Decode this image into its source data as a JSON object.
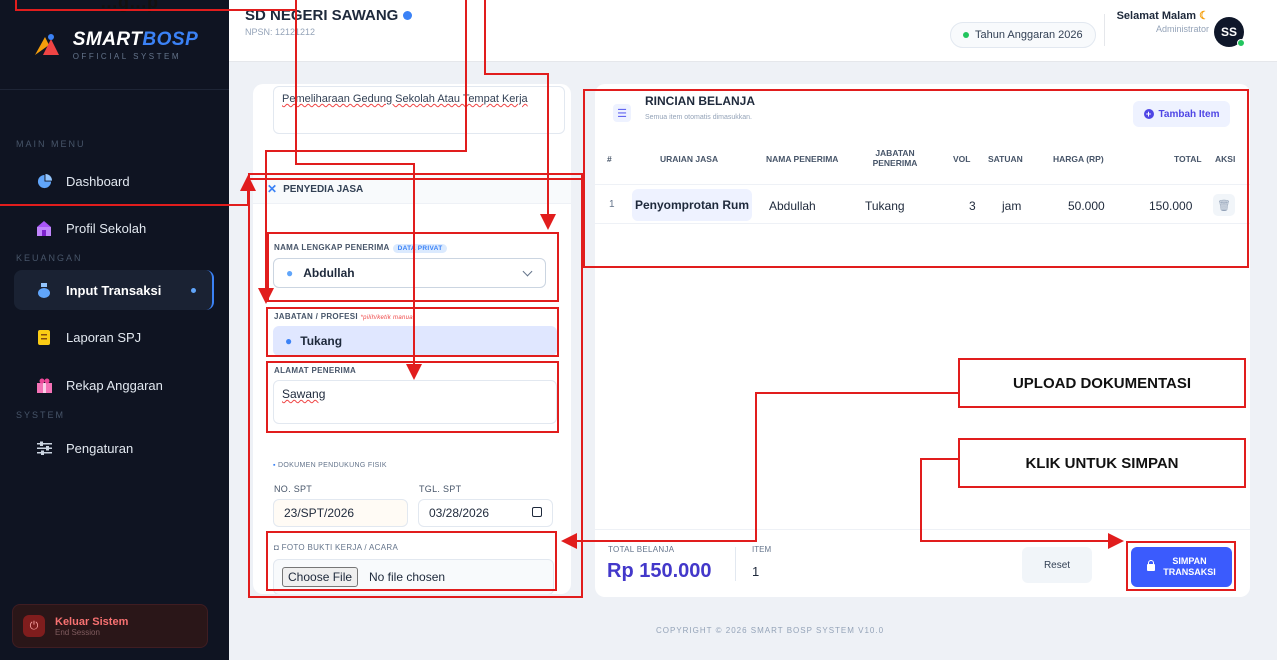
{
  "sidebar": {
    "logo_title_main": "SMART",
    "logo_title_accent": "BOSP",
    "logo_subtitle": "OFFICIAL SYSTEM",
    "section_main": "MAIN MENU",
    "section_finance": "KEUANGAN",
    "section_system": "SYSTEM",
    "items": [
      {
        "label": "Dashboard",
        "icon": "pie-chart-icon"
      },
      {
        "label": "Profil Sekolah",
        "icon": "school-icon"
      },
      {
        "label": "Input Transaksi",
        "icon": "money-bag-icon",
        "active": true
      },
      {
        "label": "Laporan SPJ",
        "icon": "document-icon"
      },
      {
        "label": "Rekap Anggaran",
        "icon": "gift-icon"
      },
      {
        "label": "Pengaturan",
        "icon": "sliders-icon"
      }
    ],
    "logout_title": "Keluar Sistem",
    "logout_sub": "End Session"
  },
  "header": {
    "school_name": "SD NEGERI SAWANG",
    "npsn": "NPSN: 12121212",
    "year_badge": "Tahun Anggaran 2026",
    "greeting": "Selamat Malam",
    "role": "Administrator",
    "avatar_initials": "SS"
  },
  "form": {
    "description_value": "Pemeliharaan Gedung Sekolah Atau Tempat Kerja",
    "provider_section": "PENYEDIA JASA",
    "recipient_label": "NAMA LENGKAP PENERIMA",
    "private_badge": "DATA PRIVAT",
    "recipient_value": "Abdullah",
    "job_label": "JABATAN / PROFESI",
    "job_hint": "*pilih/ketik manual",
    "job_value": "Tukang",
    "address_label": "ALAMAT PENERIMA",
    "address_value": "Sawang",
    "doc_section": "DOKUMEN PENDUKUNG FISIK",
    "spt_no_label": "NO. SPT",
    "spt_no_value": "23/SPT/2026",
    "spt_date_label": "TGL. SPT",
    "spt_date_value": "03/28/2026",
    "photo_label": "FOTO BUKTI KERJA / ACARA",
    "choose_file": "Choose File",
    "no_file": "No file chosen"
  },
  "table": {
    "title": "RINCIAN BELANJA",
    "subtitle": "Semua item otomatis dimasukkan.",
    "add_button": "Tambah Item",
    "columns": [
      "#",
      "URAIAN JASA",
      "NAMA PENERIMA",
      "JABATAN PENERIMA",
      "VOL",
      "SATUAN",
      "HARGA (RP)",
      "TOTAL",
      "AKSI"
    ],
    "rows": [
      {
        "no": "1",
        "uraian": "Penyomprotan Rum",
        "nama": "Abdullah",
        "jabatan": "Tukang",
        "vol": "3",
        "satuan": "jam",
        "harga": "50.000",
        "total": "150.000"
      }
    ],
    "total_label": "TOTAL BELANJA",
    "total_value": "Rp 150.000",
    "item_label": "ITEM",
    "item_value": "1",
    "reset_button": "Reset",
    "save_button_line1": "SIMPAN",
    "save_button_line2": "TRANSAKSI"
  },
  "copyright": "COPYRIGHT © 2026 SMART BOSP SYSTEM V10.0",
  "annotations": {
    "top_label": "…g…p",
    "upload_label": "UPLOAD DOKUMENTASI",
    "save_label": "KLIK UNTUK SIMPAN"
  },
  "colors": {
    "accent": "#3b5bfd",
    "annotation": "#e11d1d",
    "sidebar_bg": "#0f1422"
  }
}
